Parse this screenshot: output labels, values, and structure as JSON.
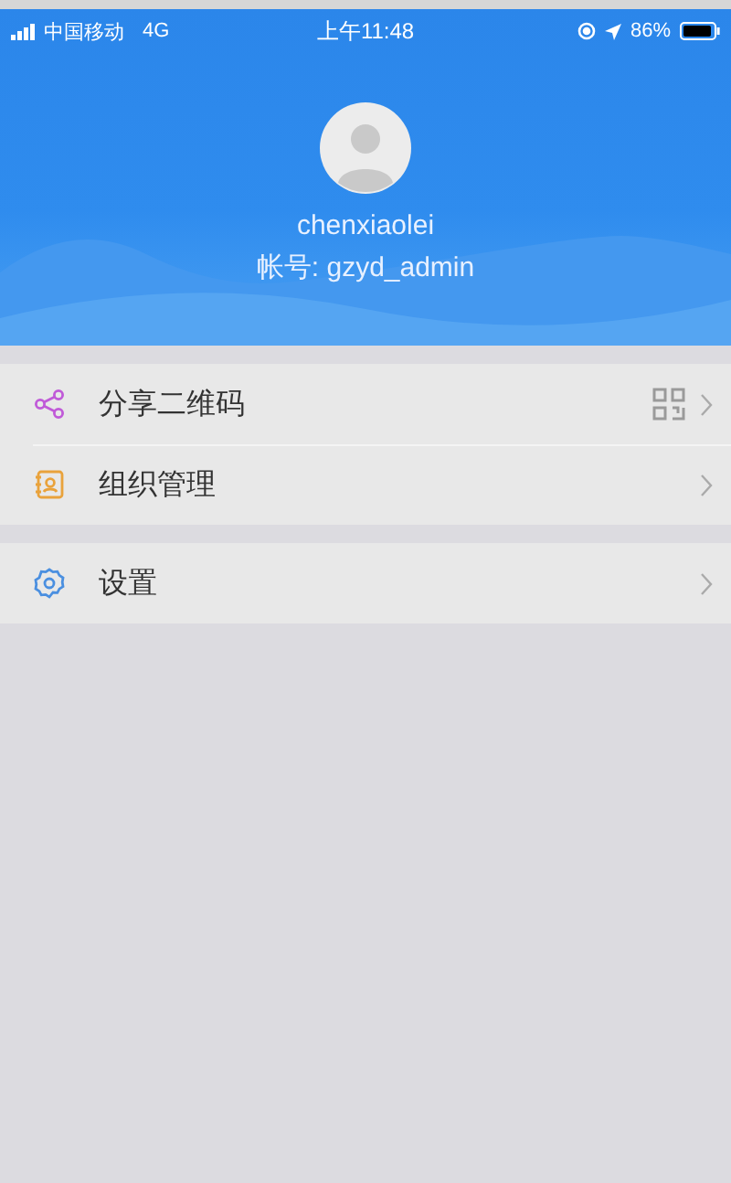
{
  "status_bar": {
    "carrier": "中国移动",
    "network": "4G",
    "time": "上午11:48",
    "battery": "86%"
  },
  "profile": {
    "name": "chenxiaolei",
    "account": "帐号: gzyd_admin"
  },
  "groups": [
    {
      "items": [
        {
          "kind": "share",
          "label": "分享二维码",
          "show_qr": true
        },
        {
          "kind": "organization",
          "label": "组织管理",
          "show_qr": false
        }
      ]
    },
    {
      "items": [
        {
          "kind": "settings",
          "label": "设置",
          "show_qr": false
        }
      ]
    }
  ]
}
